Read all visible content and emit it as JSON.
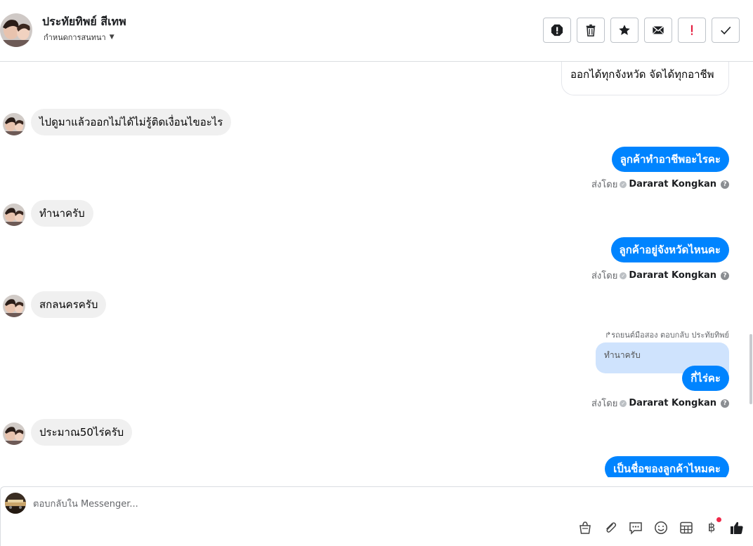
{
  "header": {
    "contact_name": "ประทัยทิพย์ สีเทพ",
    "conversation_settings": "กำหนดการสนทนา",
    "actions": [
      "mark-spam-icon",
      "delete-icon",
      "star-icon",
      "unread-mail-icon",
      "important-icon",
      "done-check-icon"
    ]
  },
  "thread": {
    "messages": [
      {
        "direction": "out",
        "text": "ออกได้ทุกจังหวัด จัดได้ทุกอาชีพ"
      },
      {
        "direction": "in",
        "text": "ไปดูมาแล้วออกไม่ได้ไม่รู้ติดเงื่อนไขอะไร"
      },
      {
        "direction": "out",
        "text": "ลูกค้าทำอาชีพอะไรคะ",
        "sent_by_prefix": "ส่งโดย",
        "sent_by": "Dararat Kongkan"
      },
      {
        "direction": "in",
        "text": "ทำนาครับ"
      },
      {
        "direction": "out",
        "text": "ลูกค้าอยู่จังหวัดไหนคะ",
        "sent_by_prefix": "ส่งโดย",
        "sent_by": "Dararat Kongkan"
      },
      {
        "direction": "in",
        "text": "สกลนครครับ"
      },
      {
        "direction": "out",
        "reply_label": "รถยนต์มือสอง ตอบกลับ ประทัยทิพย์",
        "quoted_text": "ทำนาครับ",
        "text": "กี่ไร่คะ",
        "sent_by_prefix": "ส่งโดย",
        "sent_by": "Dararat Kongkan"
      },
      {
        "direction": "in",
        "text": "ประมาณ50ไร่ครับ"
      },
      {
        "direction": "out",
        "text": "เป็นชื่อของลูกค้าไหมคะ"
      }
    ]
  },
  "composer": {
    "placeholder": "ตอบกลับใน Messenger...",
    "tools": [
      "shop-bag-icon",
      "attachment-icon",
      "saved-replies-icon",
      "emoji-icon",
      "table-icon",
      "baht-payment-icon",
      "like-icon"
    ],
    "baht_symbol": "฿"
  },
  "colors": {
    "accent": "#0084ff",
    "incoming_bubble": "#f0f0f0",
    "quote_bg": "#cfe3fd",
    "notification_dot": "#f02849"
  }
}
